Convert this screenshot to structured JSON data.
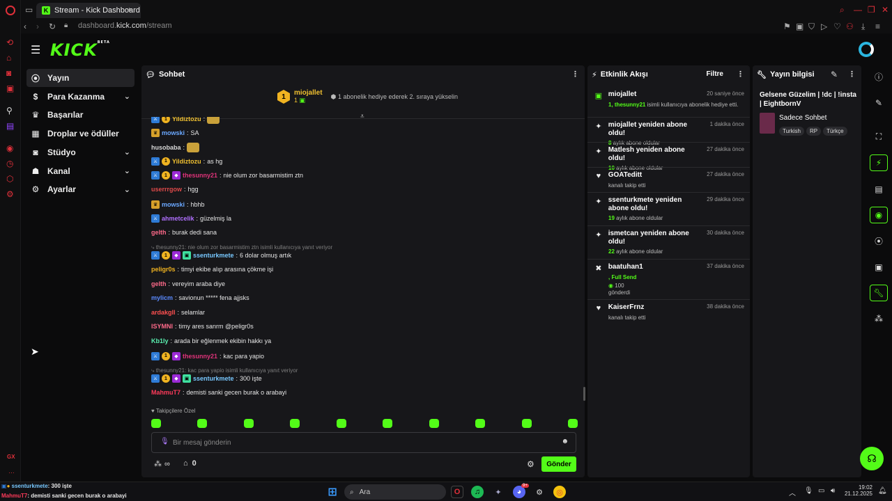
{
  "browser": {
    "tab_title": "Stream - Kick Dashboard",
    "new_tab": "+",
    "url_prefix": "dashboard.",
    "url_domain": "kick.com",
    "url_path": "/stream",
    "side_label": "GX"
  },
  "header": {
    "logo": "KICK",
    "beta": "BETA"
  },
  "sidebar": {
    "items": [
      {
        "label": "Yayın",
        "icon": "broadcast-icon",
        "active": true
      },
      {
        "label": "Para Kazanma",
        "icon": "dollar-icon",
        "chevron": true
      },
      {
        "label": "Başarılar",
        "icon": "trophy-icon"
      },
      {
        "label": "Droplar ve ödüller",
        "icon": "gift-icon"
      },
      {
        "label": "Stüdyo",
        "icon": "camera-icon",
        "chevron": true
      },
      {
        "label": "Kanal",
        "icon": "user-icon",
        "chevron": true
      },
      {
        "label": "Ayarlar",
        "icon": "gear-icon",
        "chevron": true
      }
    ]
  },
  "chat": {
    "title": "Sohbet",
    "pinned_user": "miojallet",
    "pinned_count": "1",
    "pinned_rank": "1",
    "pinned_msg": "1 abonelik hediye ederek 2. sıraya yükselin",
    "messages": [
      {
        "user": "Yildiztozu",
        "color": "#f0c030",
        "text": "",
        "badges": [
          "mod",
          "gold"
        ],
        "emote": true
      },
      {
        "user": "mowski",
        "color": "#6aa8ff",
        "text": "SA",
        "badges": [
          "crown"
        ]
      },
      {
        "user": "husobaba",
        "color": "#d8d8d8",
        "text": "",
        "badges": [],
        "emote": true
      },
      {
        "user": "Yildiztozu",
        "color": "#f0c030",
        "text": "as hg",
        "badges": [
          "mod",
          "gold"
        ]
      },
      {
        "user": "thesunny21",
        "color": "#e0337a",
        "text": "nie olum zor basarmistim ztn",
        "badges": [
          "mod",
          "gold",
          "vip"
        ]
      },
      {
        "user": "userrrgow",
        "color": "#e04a4a",
        "text": "hgg",
        "badges": []
      },
      {
        "user": "mowski",
        "color": "#6aa8ff",
        "text": "hbhb",
        "badges": [
          "crown"
        ]
      },
      {
        "user": "ahmetcelik",
        "color": "#b070ff",
        "text": "güzelmiş la",
        "badges": [
          "mod"
        ]
      },
      {
        "user": "gelth",
        "color": "#ff6a8a",
        "text": "burak dedi sana",
        "badges": []
      },
      {
        "reply": "thesunny21: nie olum zor basarmistim ztn isimli kullanıcıya yanıt veriyor"
      },
      {
        "user": "ssenturkmete",
        "color": "#78c8ff",
        "text": "6 dolar olmuş artık",
        "badges": [
          "mod",
          "gold",
          "vip",
          "og"
        ]
      },
      {
        "user": "peligr0s",
        "color": "#f0b321",
        "text": "timyi ekibe alıp arasına çökme işi",
        "badges": []
      },
      {
        "user": "gelth",
        "color": "#ff6a8a",
        "text": "vereyim araba diye",
        "badges": []
      },
      {
        "user": "mylicm",
        "color": "#5a8aff",
        "text": "savionun ***** fena ajjsks",
        "badges": []
      },
      {
        "user": "ardakgll",
        "color": "#ff5050",
        "text": "selamlar",
        "badges": []
      },
      {
        "user": "ISYMNI",
        "color": "#ff6a8a",
        "text": "timy ares sanrm @peligr0s",
        "badges": []
      },
      {
        "user": "Kb1ly",
        "color": "#5af0b0",
        "text": "arada bir eğlenmek ekibin hakkı ya",
        "badges": []
      },
      {
        "user": "thesunny21",
        "color": "#e0337a",
        "text": "kac para yapio",
        "badges": [
          "mod",
          "gold",
          "vip"
        ]
      },
      {
        "reply": "thesunny21: kac para yapio isimli kullanıcıya yanıt veriyor"
      },
      {
        "user": "ssenturkmete",
        "color": "#78c8ff",
        "text": "300 işte",
        "badges": [
          "mod",
          "gold",
          "vip",
          "og"
        ]
      },
      {
        "user": "MahmuT7",
        "color": "#ff3a5a",
        "text": "demisti sanki gecen burak o arabayi",
        "badges": []
      }
    ],
    "followers_only": "Takipçilere Özel",
    "input_placeholder": "Bir mesaj gönderin",
    "send_label": "Gönder",
    "points": "∞",
    "store_count": "0"
  },
  "activity": {
    "title": "Etkinlik Akışı",
    "filter": "Filtre",
    "items": [
      {
        "icon": "gift-icon",
        "name": "miojallet",
        "time": "20 saniye önce",
        "sub_pre": "1, thesunny21",
        "sub": " isimli kullanıcıya abonelik hediye etti."
      },
      {
        "icon": "sparkle-icon",
        "name": "miojallet yeniden abone oldu!",
        "time": "1 dakika önce",
        "sub_pre": "8",
        "sub": " aylık abone oldular"
      },
      {
        "icon": "sparkle-icon",
        "name": "Matlesh yeniden abone oldu!",
        "time": "27 dakika önce",
        "sub_pre": "10",
        "sub": " aylık abone oldular"
      },
      {
        "icon": "heart-icon",
        "name": "GOATeditt",
        "time": "27 dakika önce",
        "sub_pre": "",
        "sub": "kanalı takip etti"
      },
      {
        "icon": "sparkle-icon",
        "name": "ssenturkmete yeniden abone oldu!",
        "time": "29 dakika önce",
        "sub_pre": "19",
        "sub": " aylık abone oldular"
      },
      {
        "icon": "sparkle-icon",
        "name": "ismetcan yeniden abone oldu!",
        "time": "30 dakika önce",
        "sub_pre": "22",
        "sub": " aylık abone oldular"
      },
      {
        "icon": "kick-icon",
        "name": "baatuhan1",
        "time": "37 dakika önce",
        "sub_pre": ", Full Send",
        "sub": "",
        "amount": "100",
        "amount_sub": "gönderdi"
      },
      {
        "icon": "heart-icon",
        "name": "KaiserFrnz",
        "time": "38 dakika önce",
        "sub_pre": "",
        "sub": "kanalı takip etti"
      }
    ]
  },
  "info": {
    "title": "Yayın bilgisi",
    "stream_title": "Gelsene Güzelim | !dc | !insta | EightbornV",
    "category": "Sadece Sohbet",
    "tags": [
      "Turkish",
      "RP",
      "Türkçe"
    ]
  },
  "taskbar": {
    "overlay_line1_user": "ssenturkmete",
    "overlay_line1_text": ": 300 işte",
    "overlay_line2_user": "MahmuT7",
    "overlay_line2_text": ": demisti sanki gecen burak o arabayi",
    "search": "Ara",
    "time": "19:02",
    "date": "21.12.2025",
    "discord_badge": "9+"
  }
}
